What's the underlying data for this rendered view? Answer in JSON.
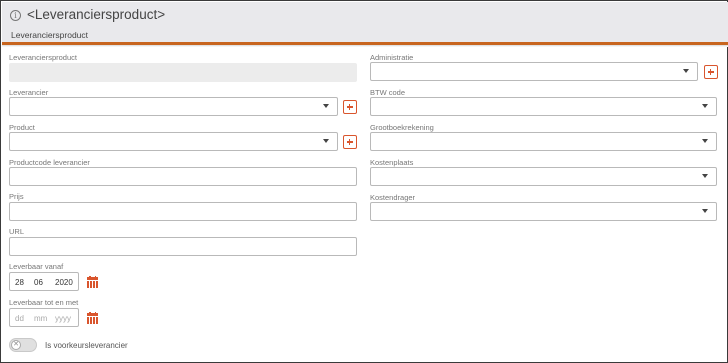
{
  "header": {
    "title": "<Leveranciersproduct>",
    "subtitle": "Leveranciersproduct"
  },
  "left": {
    "leveranciersproduct": {
      "label": "Leveranciersproduct",
      "value": ""
    },
    "leverancier": {
      "label": "Leverancier",
      "value": ""
    },
    "product": {
      "label": "Product",
      "value": ""
    },
    "productcode": {
      "label": "Productcode leverancier",
      "value": ""
    },
    "prijs": {
      "label": "Prijs",
      "value": ""
    },
    "url": {
      "label": "URL",
      "value": ""
    },
    "leverbaar_vanaf": {
      "label": "Leverbaar vanaf",
      "dd": "28",
      "mm": "06",
      "yyyy": "2020"
    },
    "leverbaar_tot": {
      "label": "Leverbaar tot en met",
      "dd": "dd",
      "mm": "mm",
      "yyyy": "yyyy"
    },
    "voorkeur": {
      "label": "Is voorkeursleverancier",
      "checked": false,
      "knob": "✕"
    }
  },
  "right": {
    "administratie": {
      "label": "Administratie",
      "value": ""
    },
    "btw": {
      "label": "BTW code",
      "value": ""
    },
    "grootboek": {
      "label": "Grootboekrekening",
      "value": ""
    },
    "kostenplaats": {
      "label": "Kostenplaats",
      "value": ""
    },
    "kostendrager": {
      "label": "Kostendrager",
      "value": ""
    }
  },
  "icons": {
    "info": "i"
  },
  "colors": {
    "accent": "#c8651f",
    "action": "#d9552d",
    "header_bg": "#e9e9ec"
  }
}
